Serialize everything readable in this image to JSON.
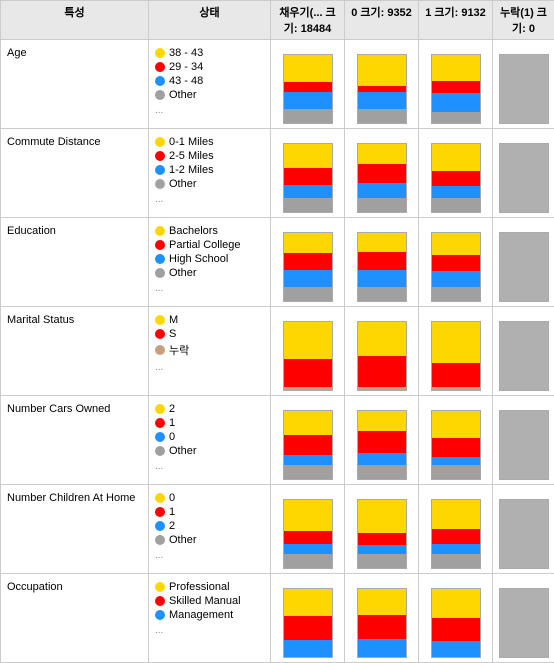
{
  "headers": {
    "feature": "특성",
    "state": "상태",
    "fill": "채우기(... 크기: 18484",
    "col0": "0 크기: 9352",
    "col1": "1 크기: 9132",
    "colNulak": "누락(1) 크기: 0"
  },
  "rows": [
    {
      "id": "age",
      "feature": "Age",
      "legend": [
        {
          "color": "yellow",
          "label": "38 - 43"
        },
        {
          "color": "red",
          "label": "29 - 34"
        },
        {
          "color": "blue",
          "label": "43 - 48"
        },
        {
          "color": "gray",
          "label": "Other"
        }
      ],
      "bars": {
        "fill": [
          40,
          15,
          25,
          20
        ],
        "col0": [
          45,
          10,
          25,
          20
        ],
        "col1": [
          38,
          18,
          28,
          16
        ]
      }
    },
    {
      "id": "commute",
      "feature": "Commute Distance",
      "legend": [
        {
          "color": "yellow",
          "label": "0-1 Miles"
        },
        {
          "color": "red",
          "label": "2-5 Miles"
        },
        {
          "color": "blue",
          "label": "1-2 Miles"
        },
        {
          "color": "gray",
          "label": "Other"
        }
      ],
      "bars": {
        "fill": [
          35,
          25,
          20,
          20
        ],
        "col0": [
          30,
          28,
          22,
          20
        ],
        "col1": [
          40,
          22,
          18,
          20
        ]
      }
    },
    {
      "id": "education",
      "feature": "Education",
      "legend": [
        {
          "color": "yellow",
          "label": "Bachelors"
        },
        {
          "color": "red",
          "label": "Partial College"
        },
        {
          "color": "blue",
          "label": "High School"
        },
        {
          "color": "gray",
          "label": "Other"
        }
      ],
      "bars": {
        "fill": [
          30,
          25,
          25,
          20
        ],
        "col0": [
          28,
          26,
          26,
          20
        ],
        "col1": [
          32,
          24,
          24,
          20
        ]
      }
    },
    {
      "id": "marital",
      "feature": "Marital Status",
      "legend": [
        {
          "color": "yellow",
          "label": "M"
        },
        {
          "color": "red",
          "label": "S"
        },
        {
          "color": "brown",
          "label": "누락"
        }
      ],
      "bars": {
        "fill": [
          55,
          40,
          5
        ],
        "col0": [
          50,
          45,
          5
        ],
        "col1": [
          60,
          35,
          5
        ]
      }
    },
    {
      "id": "numcars",
      "feature": "Number Cars Owned",
      "legend": [
        {
          "color": "yellow",
          "label": "2"
        },
        {
          "color": "red",
          "label": "1"
        },
        {
          "color": "blue",
          "label": "0"
        },
        {
          "color": "gray",
          "label": "Other"
        }
      ],
      "bars": {
        "fill": [
          35,
          30,
          15,
          20
        ],
        "col0": [
          30,
          32,
          18,
          20
        ],
        "col1": [
          40,
          28,
          12,
          20
        ]
      }
    },
    {
      "id": "numchildren",
      "feature": "Number Children At Home",
      "legend": [
        {
          "color": "yellow",
          "label": "0"
        },
        {
          "color": "red",
          "label": "1"
        },
        {
          "color": "blue",
          "label": "2"
        },
        {
          "color": "gray",
          "label": "Other"
        }
      ],
      "bars": {
        "fill": [
          45,
          20,
          15,
          20
        ],
        "col0": [
          48,
          18,
          14,
          20
        ],
        "col1": [
          42,
          22,
          16,
          20
        ]
      }
    },
    {
      "id": "occupation",
      "feature": "Occupation",
      "legend": [
        {
          "color": "yellow",
          "label": "Professional"
        },
        {
          "color": "red",
          "label": "Skilled Manual"
        },
        {
          "color": "blue",
          "label": "Management"
        }
      ],
      "bars": {
        "fill": [
          40,
          35,
          25
        ],
        "col0": [
          38,
          36,
          26
        ],
        "col1": [
          42,
          34,
          24
        ]
      }
    }
  ],
  "colors": {
    "yellow": "#FFD700",
    "red": "#FF0000",
    "blue": "#1E90FF",
    "gray": "#A0A0A0",
    "brown": "#c8a080"
  }
}
